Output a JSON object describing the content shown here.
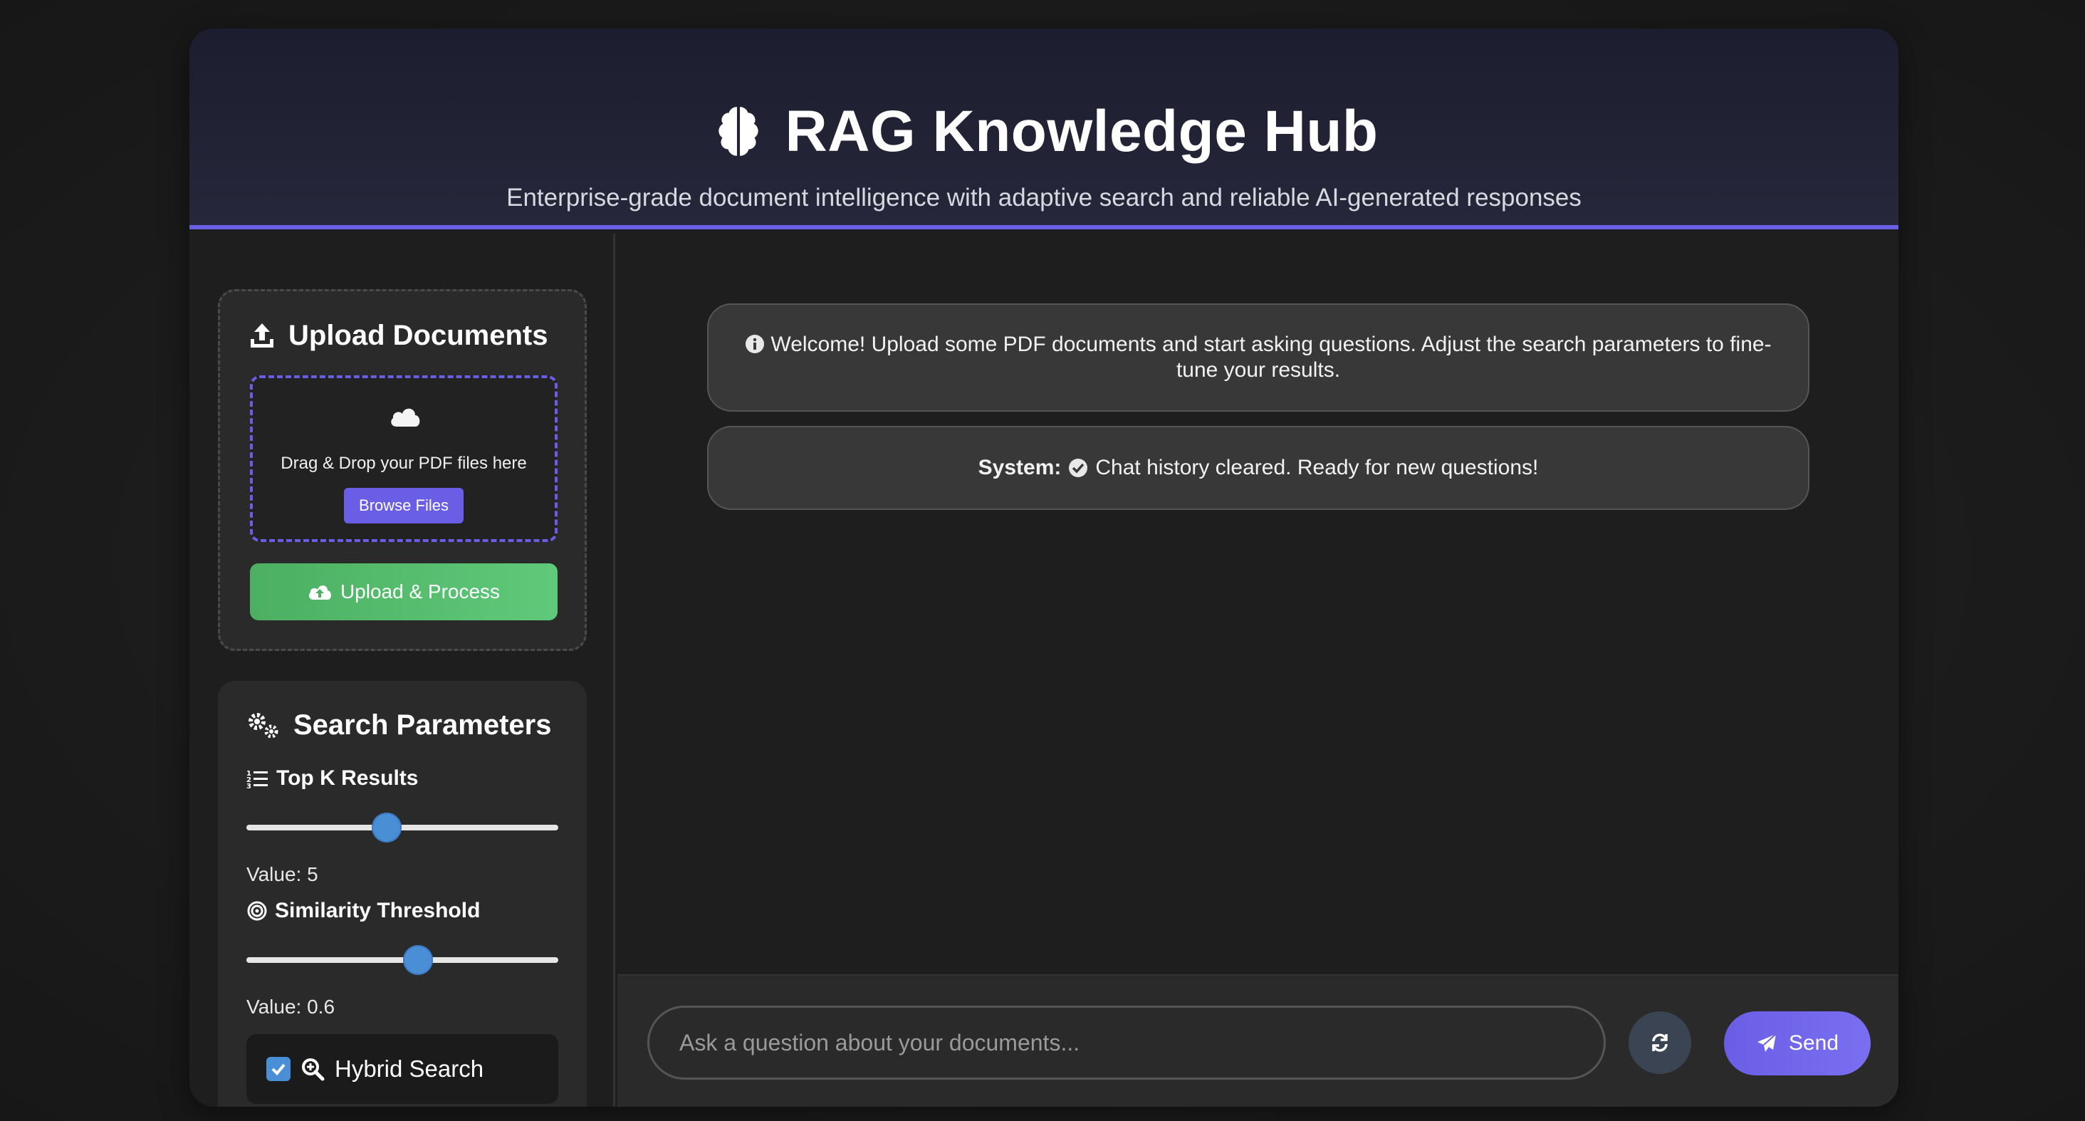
{
  "header": {
    "title": "RAG Knowledge Hub",
    "subtitle": "Enterprise-grade document intelligence with adaptive search and reliable AI-generated responses",
    "icon": "brain-icon"
  },
  "upload": {
    "title": "Upload Documents",
    "drop_text": "Drag & Drop your PDF files here",
    "browse_label": "Browse Files",
    "process_label": "Upload & Process"
  },
  "params": {
    "title": "Search Parameters",
    "top_k": {
      "label": "Top K Results",
      "value_text": "Value: 5",
      "value": 5
    },
    "similarity": {
      "label": "Similarity Threshold",
      "value_text": "Value: 0.6",
      "value": 0.6
    },
    "hybrid": {
      "label": "Hybrid Search",
      "checked": true
    }
  },
  "chat": {
    "welcome": "Welcome! Upload some PDF documents and start asking questions. Adjust the search parameters to fine-tune your results.",
    "system_prefix": "System:",
    "system_text": "Chat history cleared. Ready for new questions!"
  },
  "input": {
    "placeholder": "Ask a question about your documents...",
    "send_label": "Send"
  },
  "colors": {
    "accent": "#6a5ee6",
    "success": "#4caf62",
    "slider_thumb": "#4a8fd6"
  }
}
